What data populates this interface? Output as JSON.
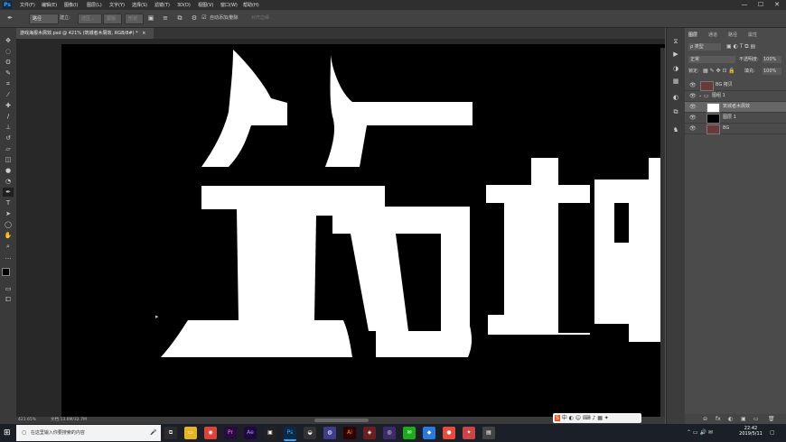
{
  "app": {
    "logo": "Ps"
  },
  "menu": [
    "文件(F)",
    "编辑(E)",
    "图像(I)",
    "图层(L)",
    "文字(Y)",
    "选择(S)",
    "滤镜(T)",
    "3D(D)",
    "视图(V)",
    "窗口(W)",
    "帮助(H)"
  ],
  "window_buttons": {
    "minimize": "—",
    "maximize": "☐",
    "close": "✕"
  },
  "options": {
    "mode": "路径",
    "make": "建立:",
    "selection": "选区...",
    "mask": "蒙版",
    "shape": "形状",
    "auto_add_delete": "自动添加/删除",
    "align_edges": "对齐边缘"
  },
  "document": {
    "tab_title": "游戏海报木屑效.psd @ 421% (筑城者木屑效, RGB/8#) *",
    "tab_close": "×",
    "zoom": "421.65%",
    "doc_size": "文档:13.6M/32.7M"
  },
  "artwork": {
    "text": "筑城"
  },
  "panels": {
    "tabs": [
      "图层",
      "通道",
      "路径",
      "属性"
    ],
    "filter_kind": "ρ 类型",
    "blend_mode": "正常",
    "opacity_label": "不透明度:",
    "opacity_value": "100%",
    "lock_label": "锁定:",
    "fill_label": "填充:",
    "fill_value": "100%",
    "layers": [
      {
        "name": "BG 拷贝",
        "thumb": "photo"
      },
      {
        "name": "图组 1",
        "thumb": "folder"
      },
      {
        "name": "筑城者木屑效",
        "thumb": "text",
        "selected": true
      },
      {
        "name": "图层 1",
        "thumb": "black"
      },
      {
        "name": "BG",
        "thumb": "photo"
      }
    ],
    "bottom_icons": [
      "⊖",
      "fx",
      "◐",
      "▣",
      "▭",
      "🗑"
    ]
  },
  "toolbar_icons": [
    "move",
    "marquee",
    "lasso",
    "quick-select",
    "crop",
    "eyedropper",
    "healing",
    "brush",
    "clone-stamp",
    "history-brush",
    "eraser",
    "gradient",
    "blur",
    "dodge",
    "pen",
    "type",
    "path-select",
    "shape",
    "hand",
    "zoom",
    "more",
    "colors"
  ],
  "taskbar": {
    "search_placeholder": "在这里输入你要搜索的内容",
    "time": "22:42",
    "date": "2019/5/11",
    "apps": [
      "edge",
      "explorer",
      "chrome",
      "premiere",
      "after-effects",
      "photoshop",
      "app",
      "app",
      "illustrator",
      "app",
      "app",
      "wechat",
      "app",
      "app",
      "app",
      "app",
      "app",
      "app"
    ],
    "colors": {
      "accent": "#31a8ff",
      "taskbar_bg": "#1b1f27"
    }
  }
}
